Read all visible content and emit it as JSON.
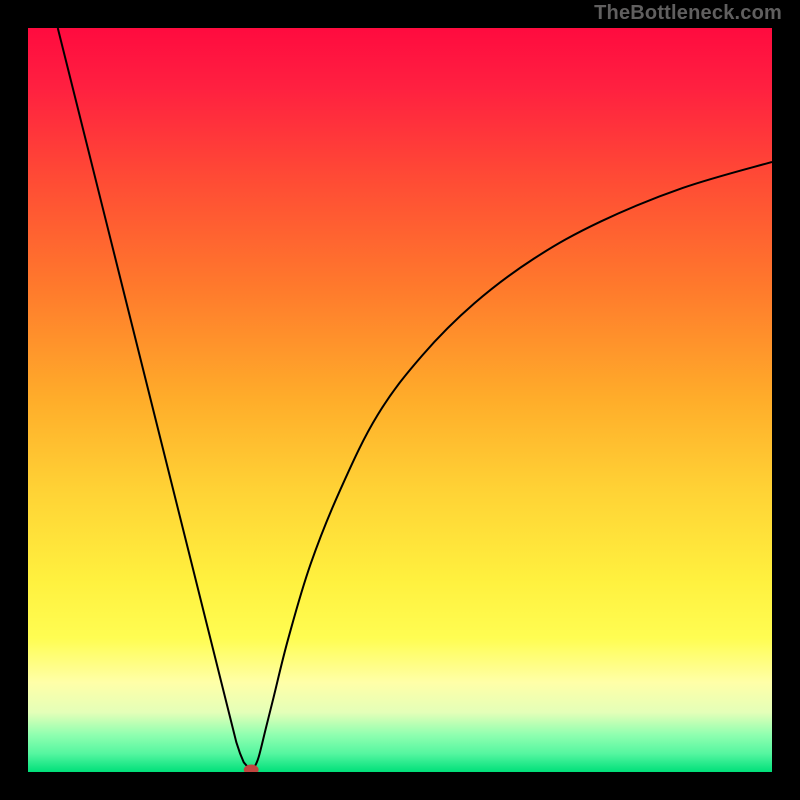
{
  "watermark": "TheBottleneck.com",
  "chart_data": {
    "type": "line",
    "title": "",
    "xlabel": "",
    "ylabel": "",
    "xlim": [
      0,
      100
    ],
    "ylim": [
      0,
      100
    ],
    "legend": false,
    "grid": false,
    "background": {
      "type": "vertical-gradient",
      "stops": [
        {
          "t": 0.0,
          "color": "#ff0b3f"
        },
        {
          "t": 0.08,
          "color": "#ff2040"
        },
        {
          "t": 0.2,
          "color": "#ff4a35"
        },
        {
          "t": 0.35,
          "color": "#ff7a2c"
        },
        {
          "t": 0.5,
          "color": "#ffad2a"
        },
        {
          "t": 0.62,
          "color": "#ffd235"
        },
        {
          "t": 0.74,
          "color": "#fff03e"
        },
        {
          "t": 0.82,
          "color": "#fffd52"
        },
        {
          "t": 0.88,
          "color": "#ffffa8"
        },
        {
          "t": 0.92,
          "color": "#e4ffb8"
        },
        {
          "t": 0.95,
          "color": "#8fffb0"
        },
        {
          "t": 0.975,
          "color": "#56f6a0"
        },
        {
          "t": 1.0,
          "color": "#00e07a"
        }
      ]
    },
    "series": [
      {
        "name": "left-branch",
        "x": [
          4.0,
          6.0,
          8.0,
          10.0,
          12.0,
          14.0,
          16.0,
          18.0,
          20.0,
          22.0,
          24.0,
          26.0,
          27.0,
          28.0,
          28.5,
          29.0,
          29.6
        ],
        "y": [
          100.0,
          92.0,
          84.0,
          76.0,
          68.0,
          60.0,
          52.0,
          44.0,
          36.0,
          28.0,
          20.0,
          12.0,
          8.0,
          4.0,
          2.5,
          1.3,
          0.6
        ]
      },
      {
        "name": "right-branch",
        "x": [
          30.4,
          31.0,
          32.0,
          33.0,
          35.0,
          38.0,
          42.0,
          47.0,
          53.0,
          60.0,
          68.0,
          77.0,
          88.0,
          100.0
        ],
        "y": [
          0.6,
          2.0,
          6.0,
          10.0,
          18.0,
          28.0,
          38.0,
          48.0,
          56.0,
          63.0,
          69.0,
          74.0,
          78.5,
          82.0
        ]
      }
    ],
    "marker": {
      "name": "min-point",
      "x": 30.0,
      "y": 0.3,
      "color": "#c1453f",
      "rx": 1.0,
      "ry": 0.7
    }
  }
}
